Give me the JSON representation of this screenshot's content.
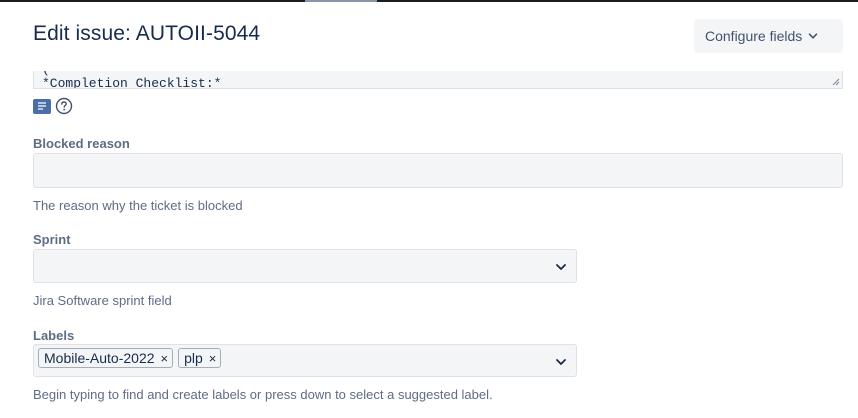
{
  "dialog": {
    "title": "Edit issue: AUTOII-5044",
    "configure_fields_label": "Configure fields"
  },
  "description": {
    "partial_line_above": "(",
    "visible_line": "*Completion Checklist:*"
  },
  "editor_tools": {
    "icons": [
      "text-mode-icon",
      "help-icon"
    ]
  },
  "fields": {
    "blocked_reason": {
      "label": "Blocked reason",
      "value": "",
      "description": "The reason why the ticket is blocked"
    },
    "sprint": {
      "label": "Sprint",
      "value": "",
      "description": "Jira Software sprint field"
    },
    "labels": {
      "label": "Labels",
      "tags": [
        "Mobile-Auto-2022",
        "plp"
      ],
      "remove_glyph": "×",
      "description": "Begin typing to find and create labels or press down to select a suggested label."
    }
  },
  "colors": {
    "title": "#172b4d",
    "label": "#5e6c84",
    "field_bg": "#f4f5f7",
    "field_border": "#dfe1e6",
    "accent_icon": "#4a6ea8"
  }
}
